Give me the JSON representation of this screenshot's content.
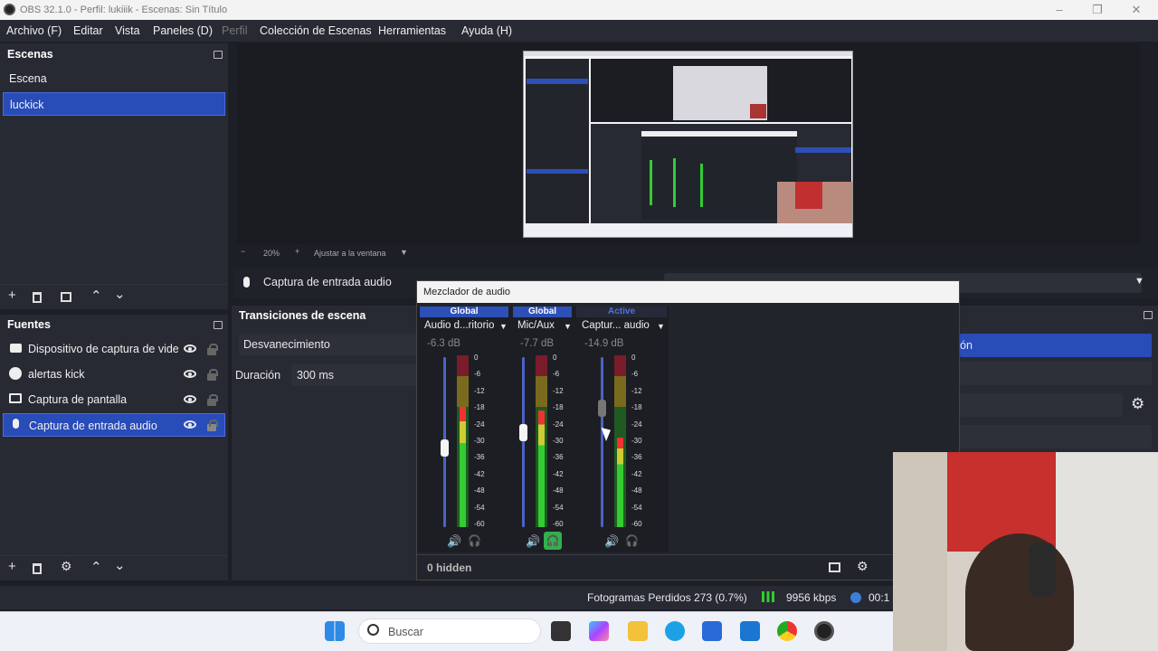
{
  "window": {
    "title": "OBS 32.1.0 - Perfil: lukiiik - Escenas: Sin Título",
    "min": "–",
    "max": "❐",
    "close": "✕"
  },
  "menu": [
    "Archivo (F)",
    "Editar",
    "Vista",
    "Paneles (D)",
    "Perfil",
    "Colección de Escenas",
    "Herramientas",
    "Ayuda (H)"
  ],
  "scenes": {
    "title": "Escenas",
    "items": [
      "Escena",
      "luckick"
    ],
    "selected": 1
  },
  "preview": {
    "zoom": "20%",
    "fit": "Ajustar a la ventana",
    "minus": "−",
    "plus": "+"
  },
  "source_bar": {
    "label": "Captura de entrada audio"
  },
  "sources": {
    "title": "Fuentes",
    "items": [
      {
        "label": "Dispositivo de captura de vide",
        "icon": "camera-icon"
      },
      {
        "label": "alertas kick",
        "icon": "globe-icon"
      },
      {
        "label": "Captura de pantalla",
        "icon": "monitor-icon"
      },
      {
        "label": "Captura de entrada audio",
        "icon": "microphone-icon"
      }
    ],
    "selected": 3
  },
  "transitions": {
    "title": "Transiciones de escena",
    "type": "Desvanecimiento",
    "duration_label": "Duración",
    "duration": "300 ms"
  },
  "controls_partial": {
    "button": "ón"
  },
  "mixer": {
    "title": "Mezclador de audio",
    "hidden": "0 hidden",
    "scale": [
      "0",
      "-6",
      "-12",
      "-18",
      "-24",
      "-30",
      "-36",
      "-42",
      "-48",
      "-54",
      "-60"
    ],
    "strips": [
      {
        "header": "Global",
        "name": "Audio d...ritorio",
        "db": "-6.3 dB",
        "level": 0.7,
        "peak": 0.47,
        "monitor": false
      },
      {
        "header": "Global",
        "name": "Mic/Aux",
        "db": "-7.7 dB",
        "level": 0.68,
        "peak": 0.56,
        "monitor": true
      },
      {
        "header": "Active",
        "name": "Captur... audio",
        "db": "-14.9 dB",
        "level": 0.52,
        "peak": 0.7,
        "monitor": false
      }
    ]
  },
  "status": {
    "dropped": "Fotogramas Perdidos 273 (0.7%)",
    "bitrate": "9956 kbps",
    "time": "00:1"
  },
  "taskbar": {
    "search": "Buscar"
  }
}
